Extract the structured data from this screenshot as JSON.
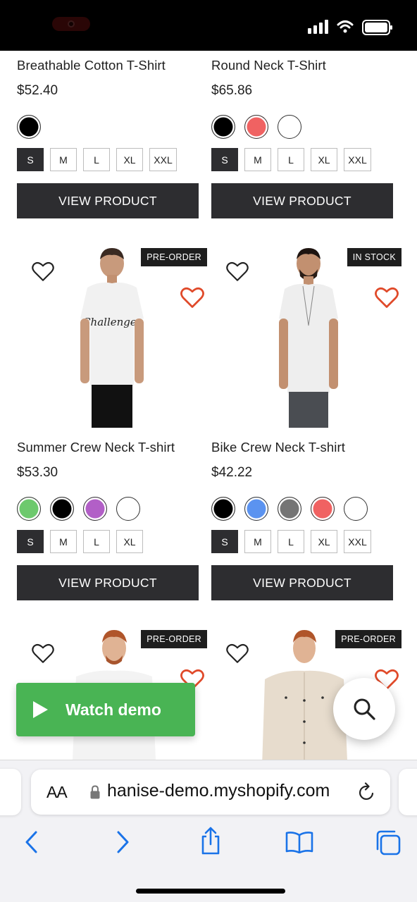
{
  "products": [
    {
      "name": "Breathable Cotton T-Shirt",
      "price": "$52.40",
      "colors": [
        "#000000"
      ],
      "sizes": [
        "S",
        "M",
        "L",
        "XL",
        "XXL"
      ],
      "selected_size": "S",
      "button_label": "VIEW PRODUCT"
    },
    {
      "name": "Round Neck T-Shirt",
      "price": "$65.86",
      "colors": [
        "#000000",
        "#f06262",
        "#ffffff"
      ],
      "sizes": [
        "S",
        "M",
        "L",
        "XL",
        "XXL"
      ],
      "selected_size": "S",
      "button_label": "VIEW PRODUCT"
    },
    {
      "badge": "PRE-ORDER",
      "name": "Summer Crew Neck T-shirt",
      "price": "$53.30",
      "colors": [
        "#6dc96d",
        "#000000",
        "#b25fc7",
        "#ffffff"
      ],
      "sizes": [
        "S",
        "M",
        "L",
        "XL"
      ],
      "selected_size": "S",
      "button_label": "VIEW PRODUCT"
    },
    {
      "badge": "IN STOCK",
      "name": "Bike Crew Neck T-shirt",
      "price": "$42.22",
      "colors": [
        "#000000",
        "#5b93f0",
        "#757575",
        "#f06262",
        "#ffffff"
      ],
      "sizes": [
        "S",
        "M",
        "L",
        "XL",
        "XXL"
      ],
      "selected_size": "S",
      "button_label": "VIEW PRODUCT"
    },
    {
      "badge": "PRE-ORDER"
    },
    {
      "badge": "PRE-ORDER"
    }
  ],
  "watch_demo": {
    "label": "Watch demo"
  },
  "browser": {
    "text_size_label": "AA",
    "url": "hanise-demo.myshopify.com"
  },
  "icons": {
    "wishlist": "heart-outline-icon",
    "favorite": "heart-filled-red-icon",
    "search": "search-icon",
    "back": "chevron-left-icon",
    "forward": "chevron-right-icon",
    "share": "share-icon",
    "bookmarks": "book-icon",
    "tabs": "tabs-icon"
  },
  "colors": {
    "button_dark": "#2d2d30",
    "accent_red": "#e04a2a",
    "demo_green": "#49b454",
    "safari_blue": "#1a73e8"
  }
}
